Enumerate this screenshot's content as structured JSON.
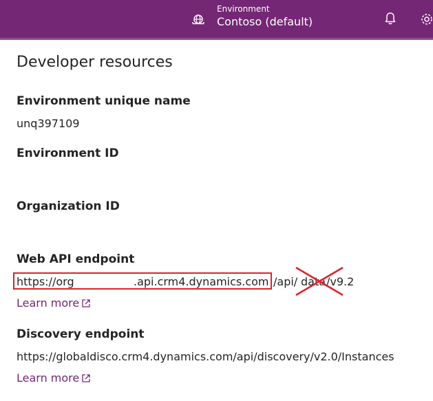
{
  "header": {
    "environment_caption": "Environment",
    "environment_name": "Contoso (default)",
    "icons": [
      "globe-icon",
      "bell-icon",
      "gear-icon"
    ],
    "background_color": "#742774"
  },
  "page": {
    "title": "Developer resources"
  },
  "fields": {
    "unique_name_label": "Environment unique name",
    "unique_name_value": "unq397109",
    "environment_id_label": "Environment ID",
    "organization_id_label": "Organization ID",
    "web_api_label": "Web API endpoint",
    "web_api_url_prefix": "https://org",
    "web_api_url_host": ".api.crm4.dynamics.com",
    "web_api_url_path1": "/api/",
    "web_api_url_path2": "data",
    "web_api_url_path3": "/v9.2",
    "web_api_learn_more": "Learn more",
    "discovery_label": "Discovery endpoint",
    "discovery_url": "https://globaldisco.crm4.dynamics.com/api/discovery/v2.0/Instances",
    "discovery_learn_more": "Learn more"
  },
  "annotations": {
    "highlight_color": "#e0202a"
  }
}
